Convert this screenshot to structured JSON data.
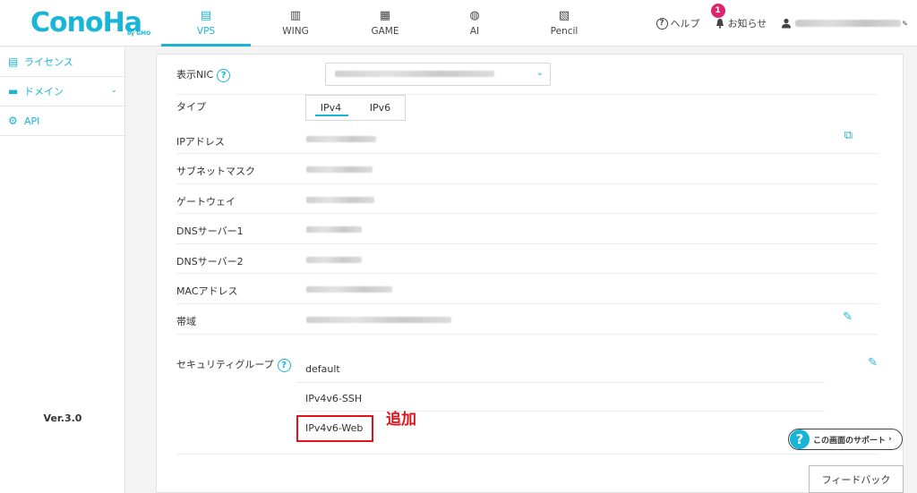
{
  "brand": {
    "logo": "ConoHa",
    "logo_sub": "by GMO",
    "accent": "#19b5d6",
    "highlight": "#e0131a"
  },
  "nav": {
    "tabs": [
      {
        "label": "VPS",
        "icon": "server-icon",
        "glyph": "▤"
      },
      {
        "label": "WING",
        "icon": "wing-icon",
        "glyph": "▥"
      },
      {
        "label": "GAME",
        "icon": "gamepad-icon",
        "glyph": "▦"
      },
      {
        "label": "AI",
        "icon": "ai-icon",
        "glyph": "◍"
      },
      {
        "label": "Pencil",
        "icon": "pencil-doc-icon",
        "glyph": "▧"
      }
    ]
  },
  "header_right": {
    "help": "ヘルプ",
    "notice": "お知らせ",
    "notice_count": "1"
  },
  "sidebar": {
    "items": [
      {
        "label": "ライセンス",
        "icon": "license-icon",
        "glyph": "▤"
      },
      {
        "label": "ドメイン",
        "icon": "domain-icon",
        "glyph": "▬",
        "chevron": "⌄"
      },
      {
        "label": "API",
        "icon": "api-gear-icon",
        "glyph": "⚙"
      }
    ],
    "version": "Ver.3.0"
  },
  "detail": {
    "nic_label": "表示NIC",
    "type_label": "タイプ",
    "type_tabs": [
      "IPv4",
      "IPv6"
    ],
    "ip_label": "IPアドレス",
    "subnet_label": "サブネットマスク",
    "gateway_label": "ゲートウェイ",
    "dns1_label": "DNSサーバー1",
    "dns2_label": "DNSサーバー2",
    "mac_label": "MACアドレス",
    "bandwidth_label": "帯域",
    "sg_label": "セキュリティグループ",
    "sg_items": [
      "default",
      "IPv4v6-SSH",
      "IPv4v6-Web"
    ],
    "annotation": "追加"
  },
  "support_label": "この画面のサポート",
  "feedback_label": "フィードバック"
}
